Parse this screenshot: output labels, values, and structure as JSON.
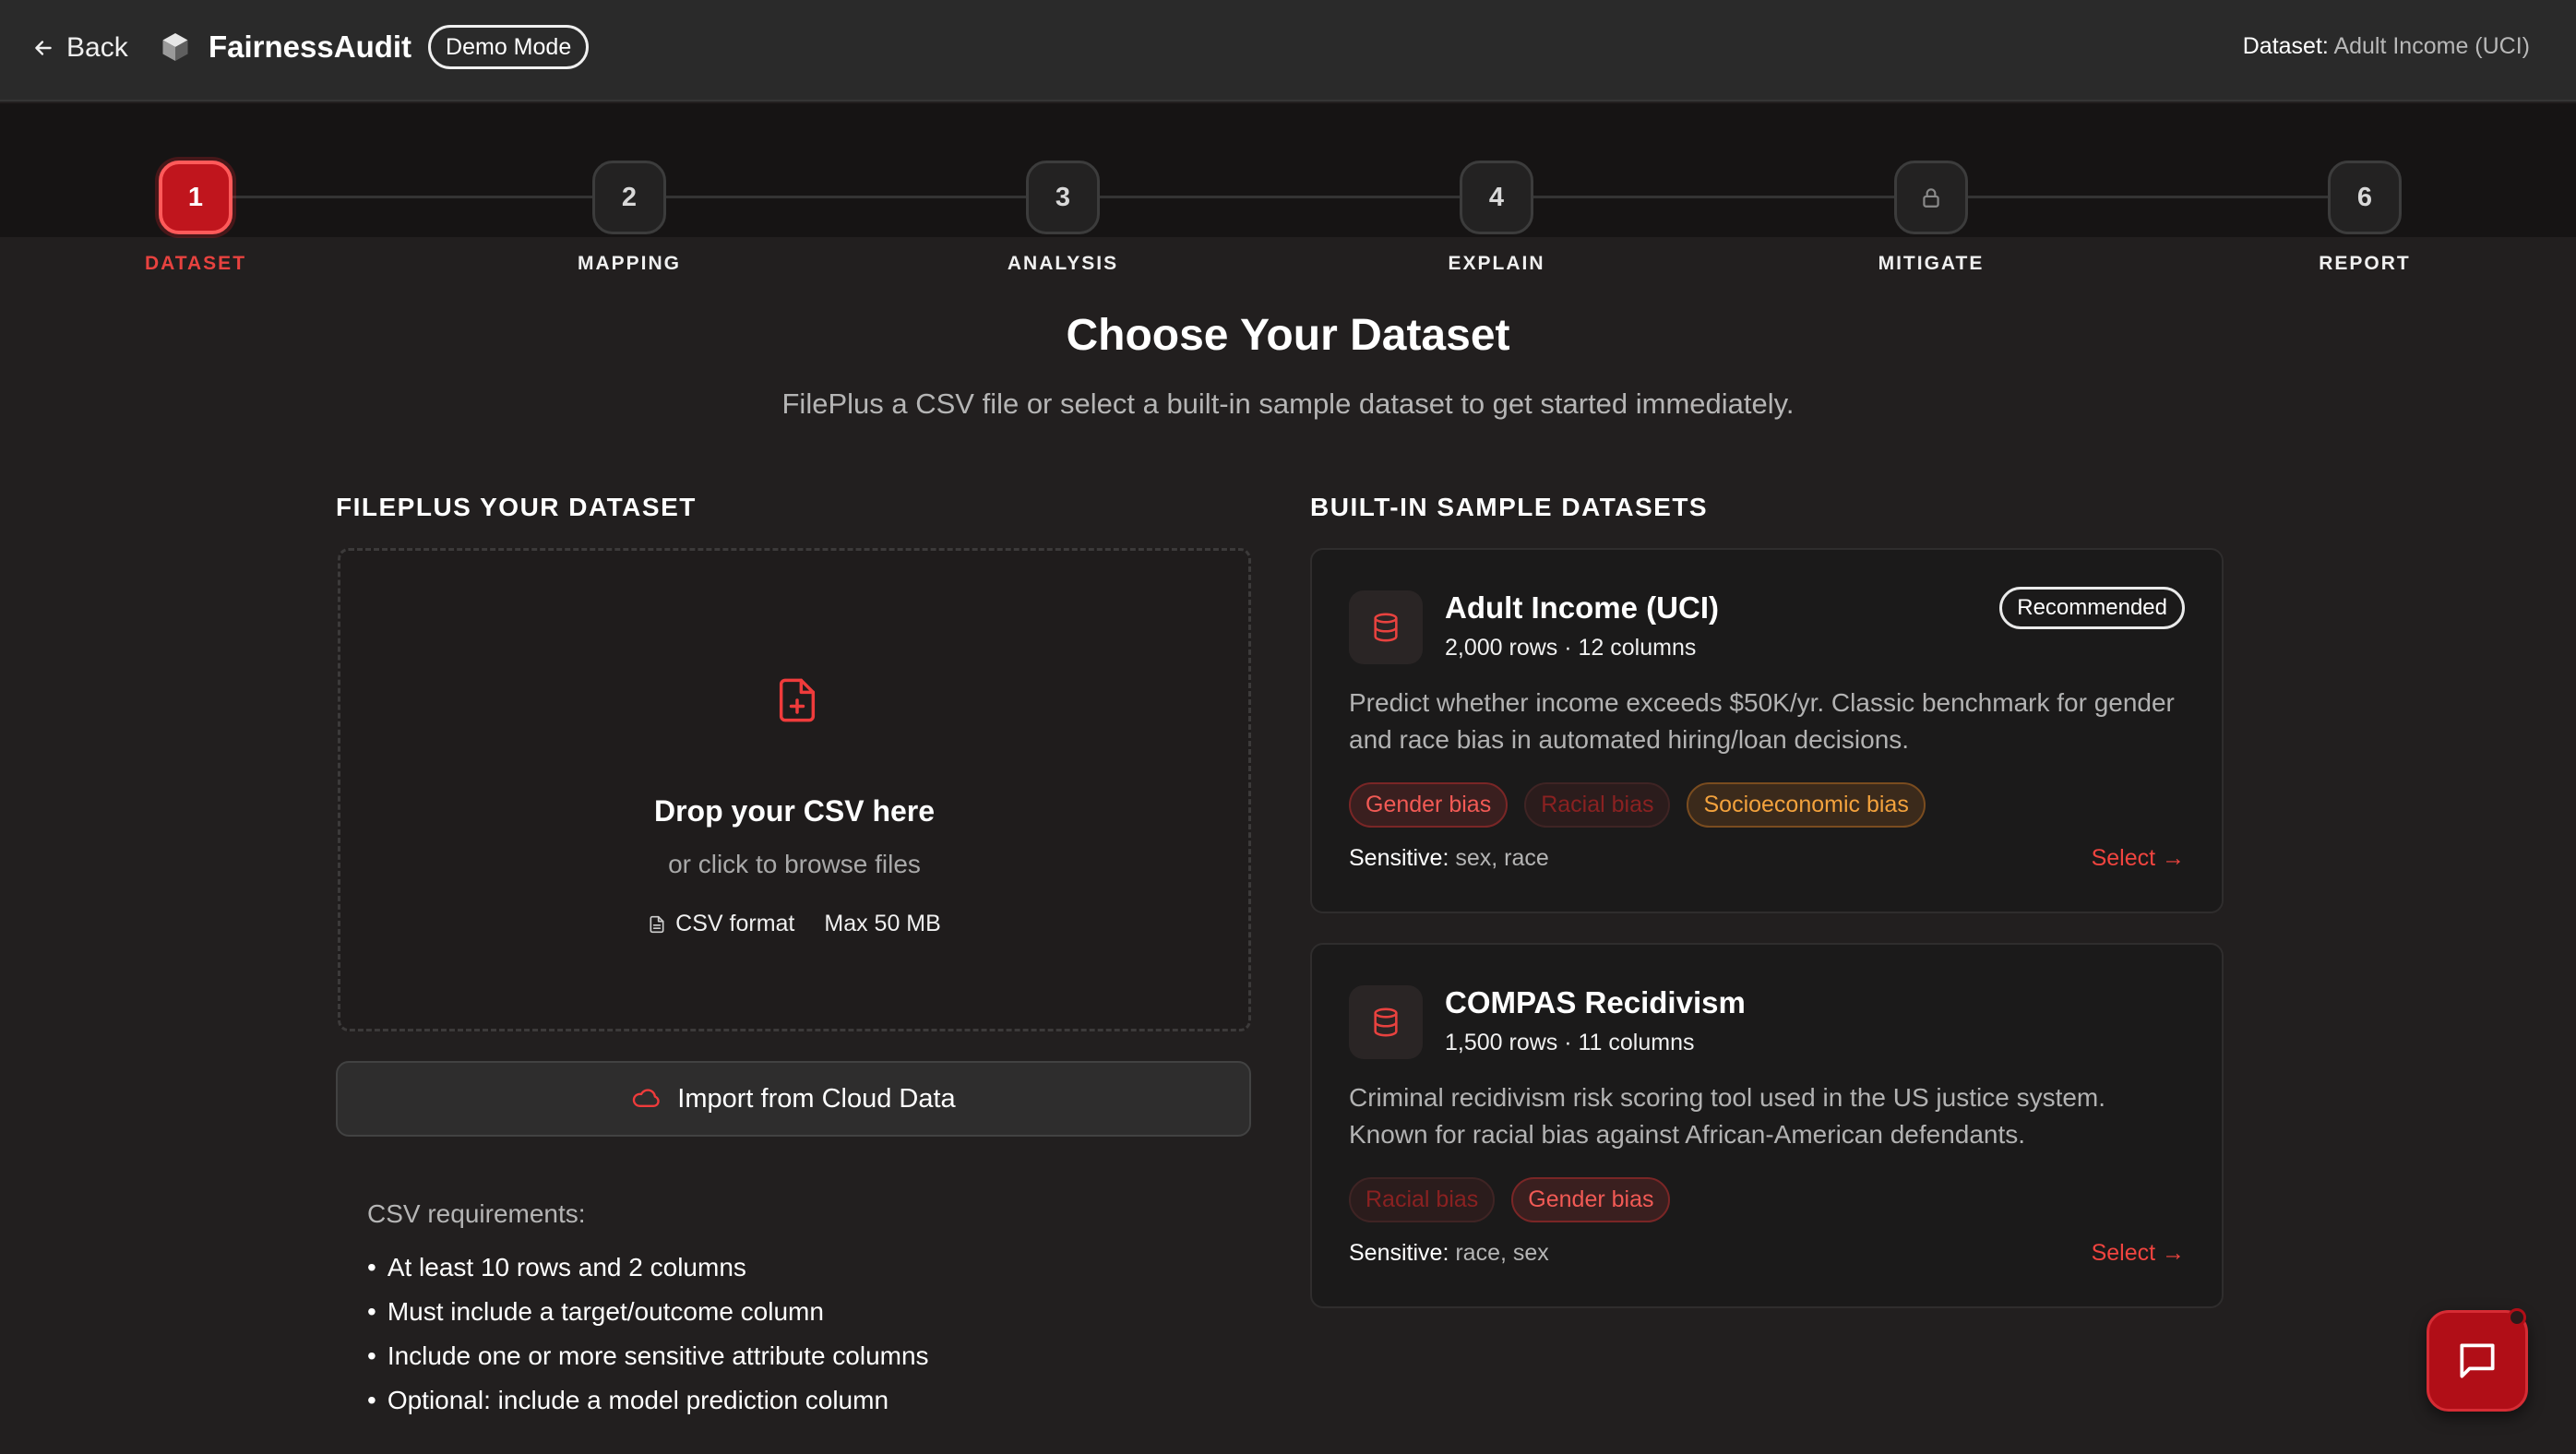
{
  "header": {
    "back_label": "Back",
    "app_name": "FairnessAudit",
    "mode_badge": "Demo Mode",
    "dataset_key": "Dataset:",
    "dataset_value": "Adult Income (UCI)"
  },
  "stepper": {
    "steps": [
      {
        "number": "1",
        "label": "DATASET",
        "state": "active"
      },
      {
        "number": "2",
        "label": "MAPPING",
        "state": "pending"
      },
      {
        "number": "3",
        "label": "ANALYSIS",
        "state": "pending"
      },
      {
        "number": "4",
        "label": "EXPLAIN",
        "state": "pending"
      },
      {
        "number": "",
        "label": "MITIGATE",
        "state": "locked",
        "icon": "lock-icon"
      },
      {
        "number": "6",
        "label": "REPORT",
        "state": "pending"
      }
    ]
  },
  "page": {
    "title": "Choose Your Dataset",
    "subtitle": "FilePlus a CSV file or select a built-in sample dataset to get started immediately."
  },
  "upload": {
    "section_title": "FILEPLUS YOUR DATASET",
    "drop_title": "Drop your CSV here",
    "drop_subtitle": "or click to browse files",
    "format_label": "CSV format",
    "size_label": "Max 50 MB",
    "cloud_button": "Import from Cloud Data",
    "requirements_title": "CSV requirements:",
    "requirements": [
      "At least 10 rows and 2 columns",
      "Must include a target/outcome column",
      "Include one or more sensitive attribute columns",
      "Optional: include a model prediction column"
    ]
  },
  "samples": {
    "section_title": "BUILT-IN SAMPLE DATASETS",
    "datasets": [
      {
        "name": "Adult Income (UCI)",
        "meta": "2,000 rows · 12 columns",
        "badge": "Recommended",
        "description": "Predict whether income exceeds $50K/yr. Classic benchmark for gender and race bias in automated hiring/loan decisions.",
        "tags": [
          "Gender bias",
          "Racial bias",
          "Socioeconomic bias"
        ],
        "sensitive_key": "Sensitive:",
        "sensitive_value": "sex, race",
        "select_label": "Select →"
      },
      {
        "name": "COMPAS Recidivism",
        "meta": "1,500 rows · 11 columns",
        "description": "Criminal recidivism risk scoring tool used in the US justice system. Known for racial bias against African-American defendants.",
        "tags": [
          "Racial bias",
          "Gender bias"
        ],
        "sensitive_key": "Sensitive:",
        "sensitive_value": "race, sex",
        "select_label": "Select →"
      }
    ]
  },
  "colors": {
    "accent": "#c0151d",
    "accent_text": "#e8423f",
    "background": "#221f1f",
    "tag_orange": "#f3a23d"
  }
}
